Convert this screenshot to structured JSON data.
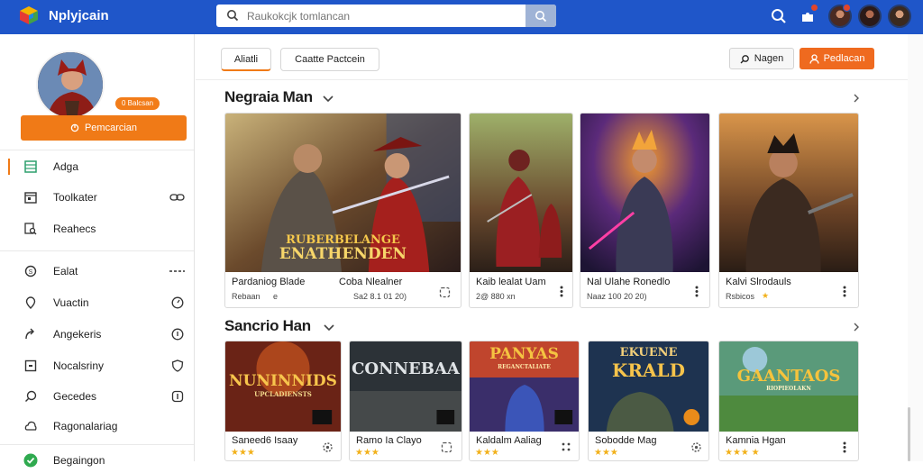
{
  "app": {
    "title": "Nplyjcain",
    "accent": "#1f56c9",
    "orange": "#f07a17"
  },
  "search": {
    "placeholder": "Raukokcjk tomlancan"
  },
  "topbar": {
    "icons": [
      "search-icon",
      "puzzle-icon",
      "avatar",
      "avatar",
      "avatar"
    ]
  },
  "profile": {
    "badge": "0 Balcsan",
    "button_label": "Pemcarcian"
  },
  "sidebar": {
    "primary": [
      {
        "label": "Adga",
        "icon": "grid-icon",
        "active": true
      },
      {
        "label": "Toolkater",
        "icon": "calendar-icon",
        "right_icon": "link-icon"
      },
      {
        "label": "Reahecs",
        "icon": "search-doc-icon"
      }
    ],
    "secondary": [
      {
        "label": "Ealat",
        "icon": "coin-icon",
        "right_icon": "dash-icon"
      },
      {
        "label": "Vuactin",
        "icon": "pin-icon",
        "right_icon": "clock-icon"
      },
      {
        "label": "Angekeris",
        "icon": "arrow-out-icon",
        "right_icon": "clock-icon"
      },
      {
        "label": "Nocalsriny",
        "icon": "square-icon",
        "right_icon": "shield-icon"
      },
      {
        "label": "Gecedes",
        "icon": "comment-icon",
        "right_icon": "info-icon"
      },
      {
        "label": "Ragonalariag",
        "icon": "cloud-icon"
      },
      {
        "label": "Begaingon",
        "icon": "check-icon"
      }
    ]
  },
  "tabs": [
    {
      "label": "Aliatli",
      "active": true
    },
    {
      "label": "Caatte Pactcein"
    }
  ],
  "actions": {
    "secondary_label": "Nagen",
    "primary_label": "Pedlacan"
  },
  "sections": [
    {
      "title": "Negraia Man",
      "cards": [
        {
          "title": "Pardaniog Blade",
          "title2": "Coba Nlealner",
          "sub": "Rebaan",
          "sub_extra": "e",
          "meta": "Sa2 8.1 01 20)",
          "thumb_text1": "RUBERBELANGE",
          "thumb_text2": "ENATHENDEN"
        },
        {
          "title": "Kaib lealat Uam",
          "sub": "2@ 880 xn",
          "sub_extra": ""
        },
        {
          "title": "Nal Ulahe Ronedlo",
          "sub": "Naaz 100 20 20)",
          "sub_extra": ""
        },
        {
          "title": "Kalvi Slrodauls",
          "sub": "Rsbicos",
          "sub_extra": "★"
        }
      ]
    },
    {
      "title": "Sancrio Han",
      "cards": [
        {
          "title": "Saneed6 Isaay",
          "rating": "★★★",
          "thumb_text1": "NUNINNIDS",
          "thumb_text2": "UPCLADIENSTS"
        },
        {
          "title": "Ramo Ia Clayo",
          "rating": "★★★",
          "thumb_text1": "CONNEBAA",
          "thumb_text2": ""
        },
        {
          "title": "Kaldalm Aaliag",
          "rating": "★★★",
          "thumb_text1": "PANYAS",
          "thumb_text2": "REGANCTALIATE"
        },
        {
          "title": "Sobodde Mag",
          "rating": "★★★",
          "thumb_text1": "EKUENE",
          "thumb_text2": "KRALD"
        },
        {
          "title": "Kamnia Hgan",
          "rating": "★★★ ★",
          "thumb_text1": "GAANTAOS",
          "thumb_text2": "RIOPIEOLAKN"
        }
      ]
    }
  ]
}
